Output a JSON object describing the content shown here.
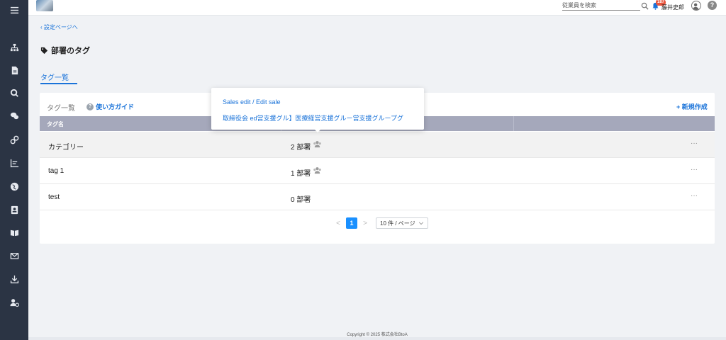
{
  "header": {
    "search_placeholder": "従業員を検索",
    "notification_count": "187",
    "user_name": "藤井史郎",
    "help_label": "?"
  },
  "sidebar": {
    "menu_icon": "hamburger-icon",
    "items": [
      {
        "icon": "org-chart-icon"
      },
      {
        "icon": "document-icon"
      },
      {
        "icon": "search-icon"
      },
      {
        "icon": "chat-icon"
      },
      {
        "icon": "link-icon"
      },
      {
        "icon": "bar-chart-icon"
      },
      {
        "icon": "globe-icon"
      },
      {
        "icon": "contact-card-icon"
      },
      {
        "icon": "book-icon"
      },
      {
        "icon": "mail-icon"
      },
      {
        "icon": "download-icon"
      },
      {
        "icon": "user-settings-icon"
      }
    ]
  },
  "main": {
    "back_link": "設定ページへ",
    "page_title": "部署のタグ",
    "tab_label": "タグ一覧",
    "card_label": "タグ一覧",
    "guide_label": "使い方ガイド",
    "new_label": "+ 新規作成",
    "table": {
      "column_name": "タグ名",
      "rows": [
        {
          "name": "カテゴリー",
          "count": "2 部署",
          "more": "···"
        },
        {
          "name": "tag 1",
          "count": "1 部署",
          "more": "···"
        },
        {
          "name": "test",
          "count": "0 部署",
          "more": "···"
        }
      ]
    },
    "pagination": {
      "prev": "<",
      "current_page": "1",
      "next": ">",
      "per_page": "10 件 / ページ"
    }
  },
  "tooltip": {
    "line1": "Sales edit / Edit sale",
    "line2": "取締役会 ed営支援グル】医療経営支援グルー営支援グループグ"
  },
  "footer": {
    "copyright": "Copyright © 2025 株式会社BtoA"
  },
  "colors": {
    "sidebar": "#2b3444",
    "accent": "#1a73d9",
    "table_header": "#a5a8bb",
    "badge": "#e8563f",
    "page_active": "#1a90ff"
  }
}
